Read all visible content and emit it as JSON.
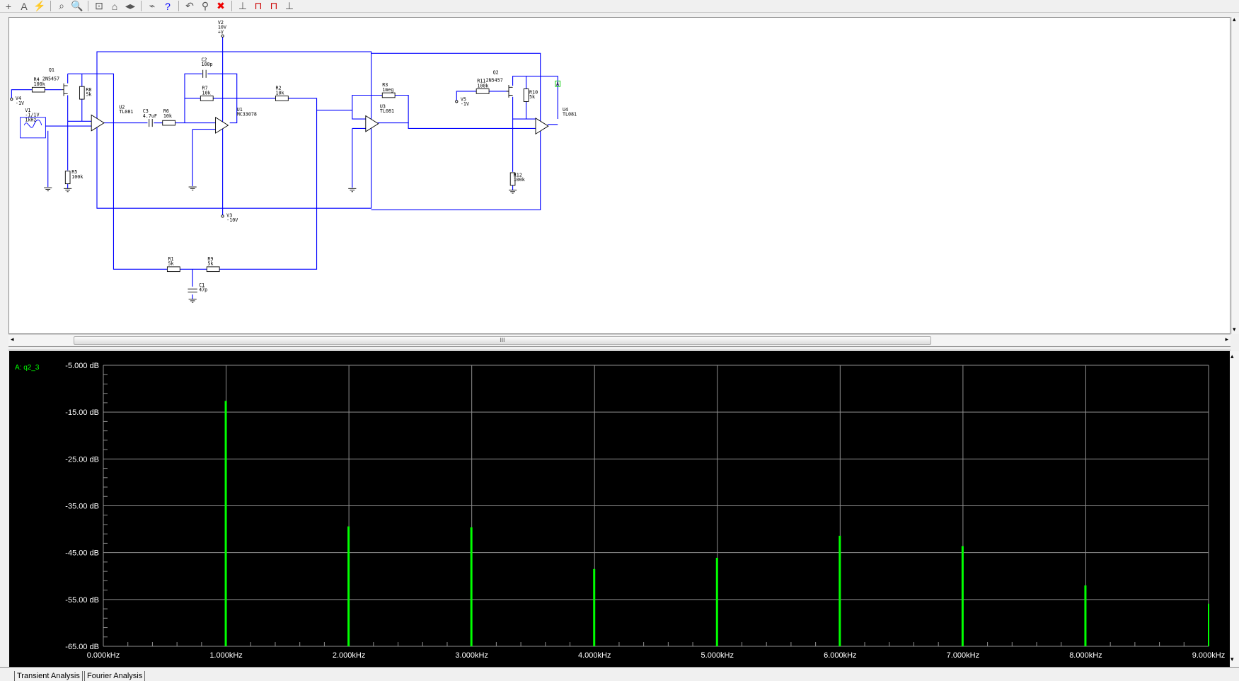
{
  "toolbar": {
    "icons": [
      "plus-icon",
      "text-icon",
      "lightning-icon",
      "probe-icon",
      "zoom-icon",
      "zoom-area-icon",
      "zoom-fit-icon",
      "pan-icon",
      "netlist-icon",
      "help-icon",
      "undo-icon",
      "stop-sim-icon",
      "close-icon",
      "transient-icon",
      "fourier-icon",
      "ac-icon",
      "dc-icon"
    ],
    "glyphs": [
      "+",
      "A",
      "⚡",
      "⌕",
      "🔍",
      "⊡",
      "⌂",
      "◂▸",
      "⌁",
      "?",
      "↶",
      "⚲",
      "✖",
      "⊥",
      "⊓",
      "⊓",
      "⊥"
    ]
  },
  "schematic": {
    "labels": {
      "v2": [
        "V2",
        "10V",
        "+V"
      ],
      "v3": [
        "V3",
        "-10V"
      ],
      "v4": [
        "V4",
        "-1V"
      ],
      "v5": [
        "V5",
        "-1V"
      ],
      "v1": [
        "V1",
        "-1/1V",
        "1kHz"
      ],
      "q1": "Q1",
      "q1_model": "2N5457",
      "r4": [
        "R4",
        "100k"
      ],
      "r8": [
        "R8",
        "5k"
      ],
      "r5": [
        "R5",
        "100k"
      ],
      "u2": [
        "U2",
        "TL081"
      ],
      "c3": [
        "C3",
        "4.7uF"
      ],
      "r6": [
        "R6",
        "10k"
      ],
      "c2": [
        "C2",
        "100p"
      ],
      "r7": [
        "R7",
        "10k"
      ],
      "u1": [
        "U1",
        "MC33078"
      ],
      "r2": [
        "R2",
        "10k"
      ],
      "r3": [
        "R3",
        "1meg"
      ],
      "u3": [
        "U3",
        "TL081"
      ],
      "q2": "Q2",
      "q2_model": "2N5457",
      "r11": [
        "R11",
        "100k"
      ],
      "r10": [
        "R10",
        "5k"
      ],
      "r12": [
        "R12",
        "100k"
      ],
      "u4": [
        "U4",
        "TL081"
      ],
      "r1": [
        "R1",
        "5k"
      ],
      "r9": [
        "R9",
        "5k"
      ],
      "c1": [
        "C1",
        "47p"
      ],
      "probe": "A"
    },
    "scroll_thumb": "III"
  },
  "colors": {
    "wire": "#0000ff",
    "trace": "#00ff00",
    "grid": "#909090",
    "probe": "#00cc00"
  },
  "tabs": [
    "Transient Analysis",
    "Fourier Analysis"
  ],
  "chart_data": {
    "type": "bar",
    "trace_label": "A: q2_3",
    "xlabel": "",
    "ylabel": "",
    "xlim": [
      0,
      9
    ],
    "ylim": [
      -65,
      -5
    ],
    "x_ticks": [
      "0.000kHz",
      "1.000kHz",
      "2.000kHz",
      "3.000kHz",
      "4.000kHz",
      "5.000kHz",
      "6.000kHz",
      "7.000kHz",
      "8.000kHz",
      "9.000kHz"
    ],
    "y_ticks": [
      "-5.000 dB",
      "-15.00 dB",
      "-25.00 dB",
      "-35.00 dB",
      "-45.00 dB",
      "-55.00 dB",
      "-65.00 dB"
    ],
    "grid": true,
    "series": [
      {
        "name": "A: q2_3",
        "x": [
          1,
          2,
          3,
          4,
          5,
          6,
          7,
          8,
          9
        ],
        "values": [
          -12.6,
          -39.4,
          -39.6,
          -48.5,
          -46.1,
          -41.4,
          -43.6,
          -52.0,
          -55.9
        ]
      }
    ]
  }
}
